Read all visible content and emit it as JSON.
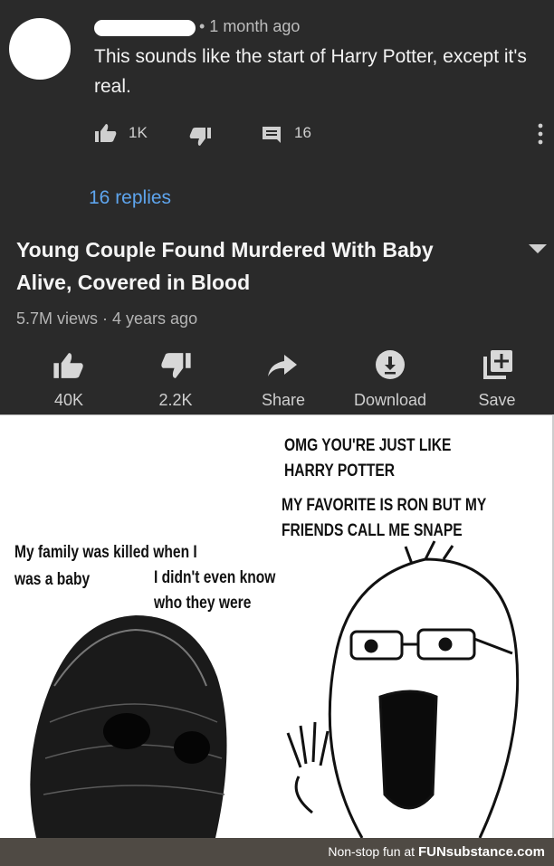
{
  "comment": {
    "time": "• 1 month ago",
    "text": "This sounds like the start of Harry Potter, except it's real.",
    "likes": "1K",
    "reply_count": "16",
    "replies_link": "16 replies"
  },
  "video": {
    "title": "Young Couple Found Murdered With Baby Alive, Covered in Blood",
    "meta": "5.7M views · 4 years ago",
    "actions": [
      {
        "label": "40K",
        "icon": "thumbs-up-icon"
      },
      {
        "label": "2.2K",
        "icon": "thumbs-down-icon"
      },
      {
        "label": "Share",
        "icon": "share-icon"
      },
      {
        "label": "Download",
        "icon": "download-icon"
      },
      {
        "label": "Save",
        "icon": "save-icon"
      }
    ]
  },
  "meme": {
    "right_line1": "OMG YOU'RE JUST LIKE",
    "right_line2": "HARRY POTTER",
    "right_line3": "MY FAVORITE IS RON BUT MY",
    "right_line4": "FRIENDS CALL ME SNAPE",
    "left_line1": "My family was killed when I",
    "left_line2": "was a baby",
    "left_line3": "I didn't even know",
    "left_line4": "who they were"
  },
  "footer": {
    "text": "Non-stop fun at",
    "brand": "FUNsubstance.com"
  },
  "colors": {
    "dark_bg": "#2a2a2a",
    "link": "#5ea5ee",
    "footer_bg": "#4f4a44"
  }
}
